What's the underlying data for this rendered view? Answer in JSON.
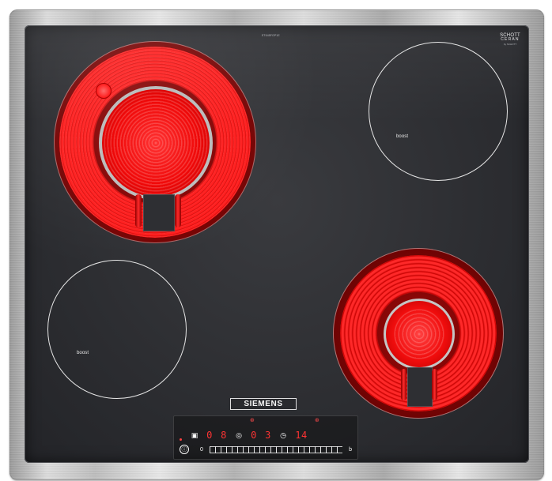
{
  "hob": {
    "model_mark": "ET645FGP1E",
    "schott_top": "SCHOTT",
    "schott_bottom": "CERAN",
    "schott_sub": "by SCHOTT",
    "brand": "SIEMENS"
  },
  "zones": {
    "front_left": {
      "state": "heating"
    },
    "front_right": {
      "label": "boost"
    },
    "back_left": {
      "label": "boost"
    },
    "back_right": {
      "state": "heating"
    }
  },
  "control_panel": {
    "top_marks": [
      "⊛",
      "⊛"
    ],
    "display": {
      "left_icon": "▣",
      "zone_1_value": "0",
      "zone_2_value": "8",
      "mode_icon": "◎",
      "zone_3_value": "0",
      "zone_4_value": "3",
      "timer_icon": "◷",
      "timer_value": "14"
    },
    "power_symbol": "ⓘ",
    "slider_start": "0",
    "slider_end": "b"
  }
}
